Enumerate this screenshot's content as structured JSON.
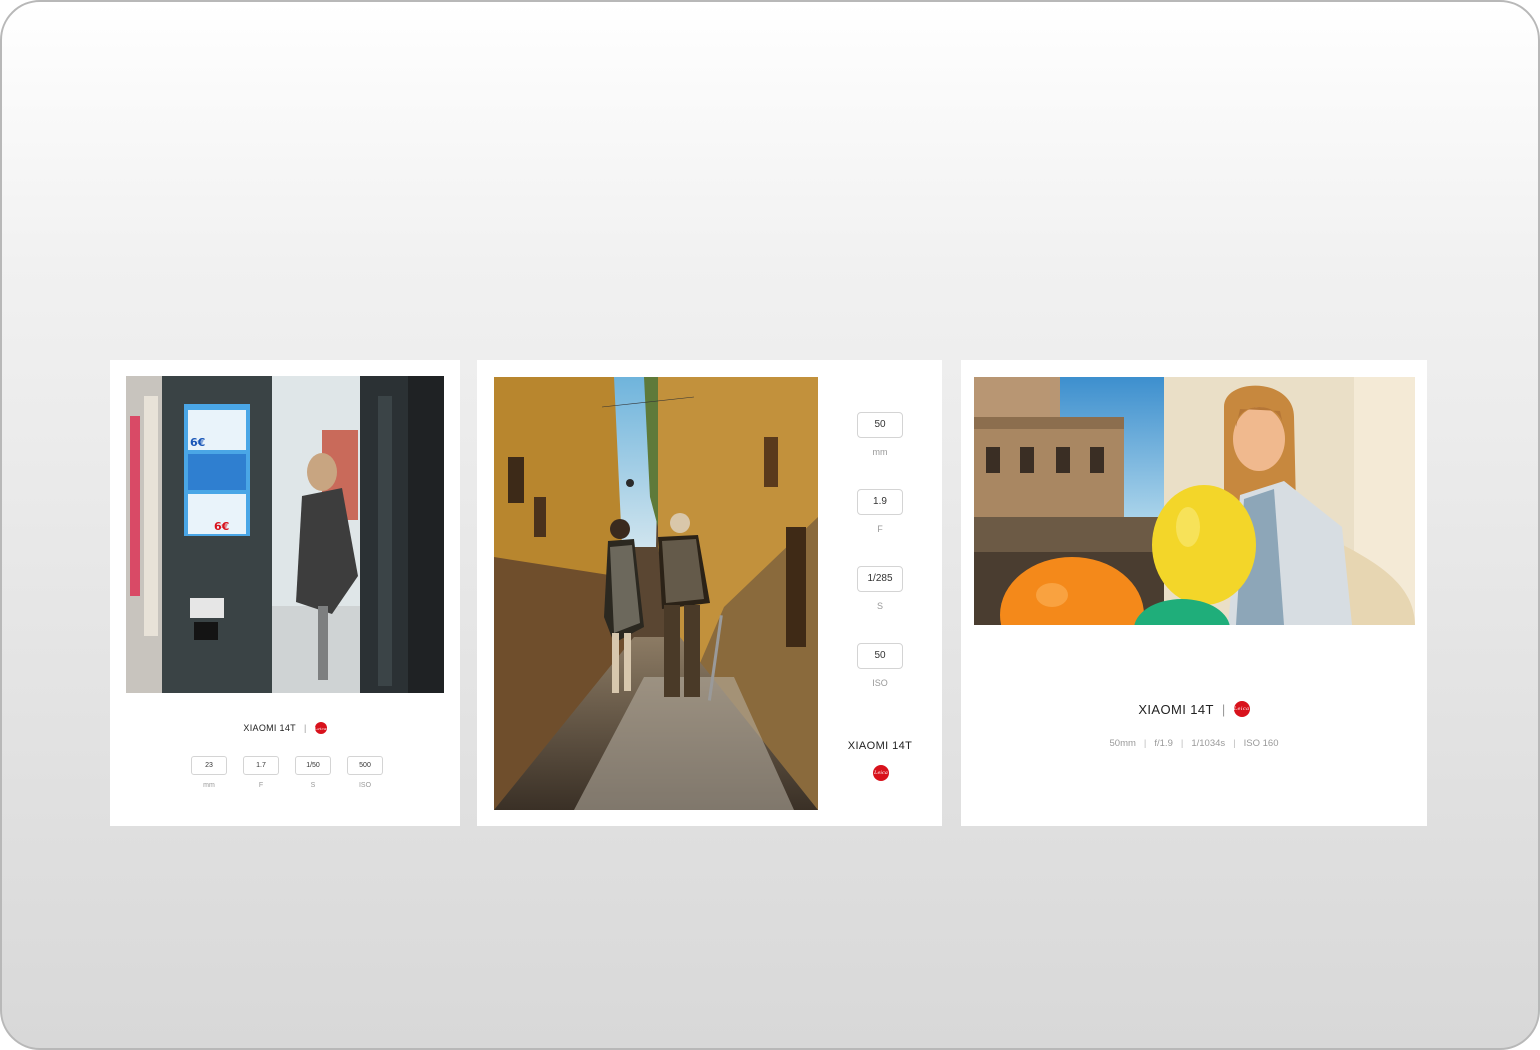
{
  "cards": [
    {
      "photo": "photo-booth-woman",
      "brand": "XIAOMI 14T",
      "separator": "|",
      "leica_mark": "Leica",
      "specs": [
        {
          "value": "23",
          "unit": "mm"
        },
        {
          "value": "1.7",
          "unit": "F"
        },
        {
          "value": "1/50",
          "unit": "S"
        },
        {
          "value": "500",
          "unit": "ISO"
        }
      ]
    },
    {
      "photo": "narrow-street-two-women",
      "brand": "XIAOMI 14T",
      "leica_mark": "Leica",
      "specs": [
        {
          "value": "50",
          "unit": "mm"
        },
        {
          "value": "1.9",
          "unit": "F"
        },
        {
          "value": "1/285",
          "unit": "S"
        },
        {
          "value": "50",
          "unit": "ISO"
        }
      ]
    },
    {
      "photo": "girl-with-balloons",
      "brand": "XIAOMI 14T",
      "separator": "|",
      "leica_mark": "Leica",
      "specs_line": [
        "50mm",
        "f/1.9",
        "1/1034s",
        "ISO 160"
      ],
      "specs_separator": "|"
    }
  ],
  "colors": {
    "leica_red": "#d8121c",
    "card_bg": "#ffffff",
    "frame_border": "#b8b8b8"
  }
}
